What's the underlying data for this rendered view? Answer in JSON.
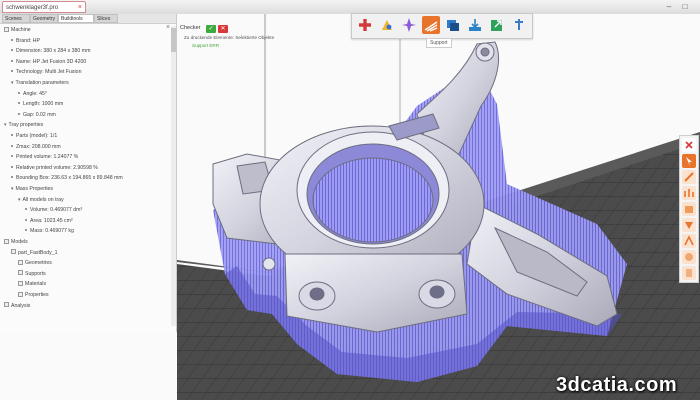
{
  "window": {
    "doc_tab_label": "schwenklager3f.pro",
    "close_glyph": "×",
    "minimize_glyph": "–",
    "maximize_glyph": "□"
  },
  "left_panel": {
    "tabs": [
      "Scenes",
      "Geometry",
      "Buildtools",
      "Slices"
    ],
    "active_tab": "Buildtools",
    "tree": [
      {
        "label": "Machine",
        "level": 0,
        "kind": "folder"
      },
      {
        "label": "Brand: HP",
        "level": 1,
        "kind": "prop"
      },
      {
        "label": "Dimension: 380 x 284 x 380 mm",
        "level": 1,
        "kind": "prop"
      },
      {
        "label": "Name: HP Jet Fusion 3D 4200",
        "level": 1,
        "kind": "prop"
      },
      {
        "label": "Technology: Multi Jet Fusion",
        "level": 1,
        "kind": "prop"
      },
      {
        "label": "Translation parameters",
        "level": 1,
        "kind": "group"
      },
      {
        "label": "Angle: 45°",
        "level": 2,
        "kind": "prop"
      },
      {
        "label": "Length: 1000 mm",
        "level": 2,
        "kind": "prop"
      },
      {
        "label": "Gap: 0.02 mm",
        "level": 2,
        "kind": "prop"
      },
      {
        "label": "Tray properties",
        "level": 0,
        "kind": "group"
      },
      {
        "label": "Parts (model): 1/1",
        "level": 1,
        "kind": "prop"
      },
      {
        "label": "Zmax: 208.000 mm",
        "level": 1,
        "kind": "prop"
      },
      {
        "label": "Printed volume: 1.24077 %",
        "level": 1,
        "kind": "prop"
      },
      {
        "label": "Relative printed volume: 2.90598 %",
        "level": 1,
        "kind": "prop"
      },
      {
        "label": "Bounding Box: 236.63 x 194.865 x 89.848 mm",
        "level": 1,
        "kind": "prop"
      },
      {
        "label": "Mass Properties",
        "level": 1,
        "kind": "group"
      },
      {
        "label": "All models on tray",
        "level": 2,
        "kind": "group"
      },
      {
        "label": "Volume: 0.469077 dm³",
        "level": 3,
        "kind": "prop"
      },
      {
        "label": "Area: 1023.45 cm²",
        "level": 3,
        "kind": "prop"
      },
      {
        "label": "Mass: 0.469077 kg",
        "level": 3,
        "kind": "prop"
      },
      {
        "label": "Models",
        "level": 0,
        "kind": "folder"
      },
      {
        "label": "part_FastBody_1",
        "level": 1,
        "kind": "part"
      },
      {
        "label": "Geometries",
        "level": 2,
        "kind": "item"
      },
      {
        "label": "Supports",
        "level": 2,
        "kind": "item"
      },
      {
        "label": "Materials",
        "level": 2,
        "kind": "item"
      },
      {
        "label": "Properties",
        "level": 2,
        "kind": "item"
      },
      {
        "label": "Analysis",
        "level": 0,
        "kind": "folder"
      }
    ]
  },
  "checker": {
    "title": "Checker",
    "line1": "Zu druckende Elemente:  Selektierte Objekte",
    "status": "Support ERR"
  },
  "toolbar": {
    "icons": [
      "support-cross-icon",
      "manual-support-icon",
      "point-support-icon",
      "volume-support-icon",
      "layers-icon",
      "export-icon",
      "share-icon",
      "pin-icon"
    ],
    "active_index": 3,
    "tooltip": "Support"
  },
  "right_toolbar": {
    "icons": [
      "close-icon",
      "cursor-icon",
      "support-type-1-icon",
      "support-type-2-icon",
      "support-type-3-icon",
      "support-type-4-icon",
      "support-type-5-icon",
      "support-type-6-icon",
      "support-type-7-icon"
    ]
  },
  "watermark": "3dcatia.com",
  "colors": {
    "accent": "#e8742c",
    "support": "#7b77e6",
    "part": "#d8d8e4",
    "floor": "#4a4a4a",
    "check_ok": "#3caa3c",
    "check_err": "#d83a3a"
  }
}
